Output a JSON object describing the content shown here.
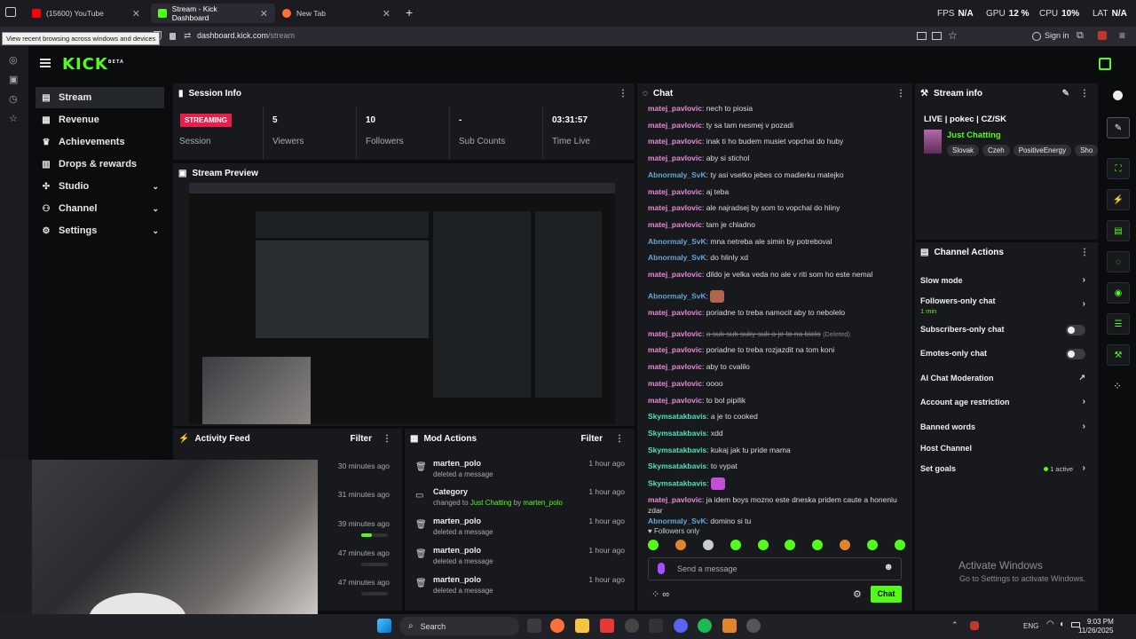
{
  "browser": {
    "tabs": [
      {
        "title": "(15600) YouTube"
      },
      {
        "title": "Stream - Kick Dashboard"
      },
      {
        "title": "New Tab"
      }
    ],
    "perf": {
      "fps_label": "FPS",
      "fps": "N/A",
      "gpu_label": "GPU",
      "gpu": "12 %",
      "cpu_label": "CPU",
      "cpu": "10%",
      "lat_label": "LAT",
      "lat": "N/A"
    },
    "tooltip": "View recent browsing across windows and devices",
    "url_host": "dashboard.kick.com",
    "url_path": "/stream",
    "signin": "Sign in"
  },
  "kick": {
    "logo": "KICK",
    "logo_sup": "BETA",
    "nav": [
      {
        "label": "Stream"
      },
      {
        "label": "Revenue"
      },
      {
        "label": "Achievements"
      },
      {
        "label": "Drops & rewards"
      },
      {
        "label": "Studio"
      },
      {
        "label": "Channel"
      },
      {
        "label": "Settings"
      }
    ],
    "session": {
      "title": "Session Info",
      "status": "STREAMING",
      "status_label": "Session",
      "stats": [
        {
          "value": "5",
          "label": "Viewers"
        },
        {
          "value": "10",
          "label": "Followers"
        },
        {
          "value": "-",
          "label": "Sub Counts"
        },
        {
          "value": "03:31:57",
          "label": "Time Live"
        }
      ]
    },
    "preview": {
      "title": "Stream Preview"
    },
    "activity": {
      "title": "Activity Feed",
      "filter": "Filter",
      "rows": [
        {
          "time": "30 minutes ago",
          "progress": 0
        },
        {
          "time": "31 minutes ago",
          "progress": 0
        },
        {
          "time": "39 minutes ago",
          "progress": 0.4
        },
        {
          "time": "47 minutes ago",
          "progress": 0
        },
        {
          "time": "47 minutes ago",
          "progress": 0
        }
      ]
    },
    "mod": {
      "title": "Mod Actions",
      "filter": "Filter",
      "rows": [
        {
          "name": "marten_polo",
          "desc": "deleted a message",
          "time": "1 hour ago"
        },
        {
          "name": "Category",
          "desc_pre": "changed to ",
          "desc_cat": "Just Chatting",
          "desc_by": " by ",
          "desc_user": "marten_polo",
          "time": "1 hour ago"
        },
        {
          "name": "marten_polo",
          "desc": "deleted a message",
          "time": "1 hour ago"
        },
        {
          "name": "marten_polo",
          "desc": "deleted a message",
          "time": "1 hour ago"
        },
        {
          "name": "marten_polo",
          "desc": "deleted a message",
          "time": "1 hour ago"
        }
      ]
    },
    "chat": {
      "title": "Chat",
      "messages": [
        {
          "user": "matej_pavlovic",
          "color": "#e88bd9",
          "text": "nech to piosia"
        },
        {
          "user": "matej_pavlovic",
          "color": "#e88bd9",
          "text": "ty sa tam nesmej v pozadi"
        },
        {
          "user": "matej_pavlovic",
          "color": "#e88bd9",
          "text": "inak ti ho budem musiet vopchat do huby"
        },
        {
          "user": "matej_pavlovic",
          "color": "#e88bd9",
          "text": "aby si stichol"
        },
        {
          "user": "Abnormaly_SvK",
          "color": "#6aa4d6",
          "text": "ty asi vsetko jebes co madierku matejko"
        },
        {
          "user": "matej_pavlovic",
          "color": "#e88bd9",
          "text": "aj teba"
        },
        {
          "user": "matej_pavlovic",
          "color": "#e88bd9",
          "text": "ale najradsej by som to vopchal do hliny"
        },
        {
          "user": "matej_pavlovic",
          "color": "#e88bd9",
          "text": "tam je chladno"
        },
        {
          "user": "Abnormaly_SvK",
          "color": "#6aa4d6",
          "text": "mna netreba ale simin by potreboval"
        },
        {
          "user": "Abnormaly_SvK",
          "color": "#6aa4d6",
          "text": "do hlinly xd"
        },
        {
          "user": "matej_pavlovic",
          "color": "#e88bd9",
          "text": "dildo je velka veda no ale v riti som ho este nemal"
        },
        {
          "user": "Abnormaly_SvK",
          "color": "#6aa4d6",
          "text": "",
          "emote": true
        },
        {
          "user": "matej_pavlovic",
          "color": "#e88bd9",
          "text": "poriadne to treba namocit aby to nebolelo"
        },
        {
          "user": "matej_pavlovic",
          "color": "#e88bd9",
          "text": "a suk suk suky suk a je to na bielo",
          "deleted": "(Deleted)"
        },
        {
          "user": "matej_pavlovic",
          "color": "#e88bd9",
          "text": "poriadne to treba rozjazdit na tom koni"
        },
        {
          "user": "matej_pavlovic",
          "color": "#e88bd9",
          "text": "aby to cvalilo"
        },
        {
          "user": "matej_pavlovic",
          "color": "#e88bd9",
          "text": "oooo"
        },
        {
          "user": "matej_pavlovic",
          "color": "#e88bd9",
          "text": "to bol pipilik"
        },
        {
          "user": "Skymsatakbavis",
          "color": "#53e0c0",
          "text": "a je to cooked"
        },
        {
          "user": "Skymsatakbavis",
          "color": "#53e0c0",
          "text": "xdd"
        },
        {
          "user": "Skymsatakbavis",
          "color": "#53e0c0",
          "text": "kukaj jak tu pride mama"
        },
        {
          "user": "Skymsatakbavis",
          "color": "#53e0c0",
          "text": "to vypat"
        },
        {
          "user": "Skymsatakbavis",
          "color": "#53e0c0",
          "text": "",
          "emote": true
        },
        {
          "user": "matej_pavlovic",
          "color": "#e88bd9",
          "text": "ja idem boys mozno este dneska pridem caute a honeniu zdar"
        },
        {
          "user": "Abnormaly_SvK",
          "color": "#6aa4d6",
          "text": "domino si tu"
        }
      ],
      "followers_only": "Followers only",
      "placeholder": "Send a message",
      "send": "Chat"
    },
    "stream_info": {
      "title": "Stream info",
      "stream_title": "LIVE | pokec | CZ/SK",
      "category": "Just Chatting",
      "tags": [
        "Slovak",
        "Czeh",
        "PositiveEnergy",
        "Sho"
      ]
    },
    "channel_actions": {
      "title": "Channel Actions",
      "rows": [
        {
          "label": "Slow mode",
          "kind": "chevron"
        },
        {
          "label": "Followers-only chat",
          "sub": "1 min",
          "kind": "chevron"
        },
        {
          "label": "Subscribers-only chat",
          "kind": "toggle"
        },
        {
          "label": "Emotes-only chat",
          "kind": "toggle"
        },
        {
          "label": "AI Chat Moderation",
          "kind": "external"
        },
        {
          "label": "Account age restriction",
          "kind": "chevron"
        },
        {
          "label": "Banned words",
          "kind": "chevron"
        },
        {
          "label": "Host Channel",
          "kind": "none"
        },
        {
          "label": "Set goals",
          "extra": "1 active",
          "kind": "chevron"
        }
      ]
    }
  },
  "windows": {
    "activate_title": "Activate Windows",
    "activate_sub": "Go to Settings to activate Windows.",
    "search": "Search",
    "lang": "ENG",
    "time": "9:03 PM",
    "date": "11/26/2025"
  },
  "colors": {
    "accent": "#53fc18",
    "live": "#e91e4b"
  }
}
